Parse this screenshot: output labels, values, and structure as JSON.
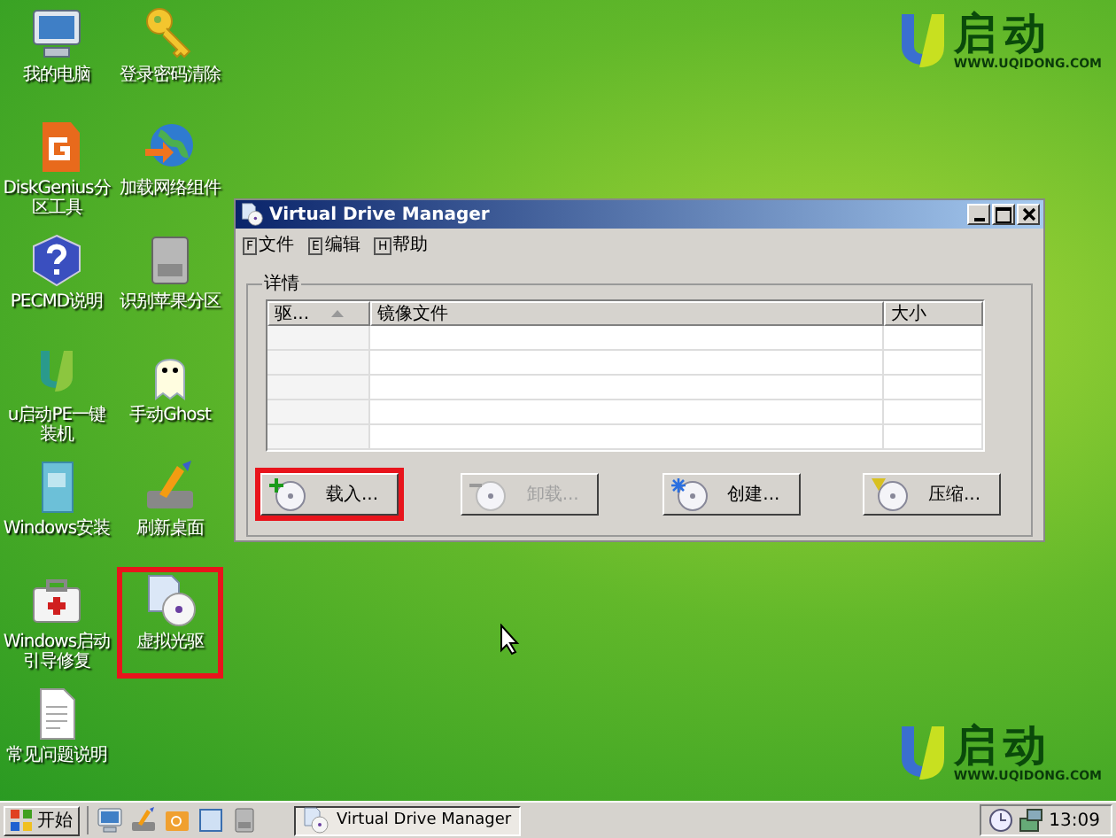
{
  "desktop": {
    "columns": [
      [
        {
          "label": "我的电脑",
          "kind": "computer",
          "highlighted": false
        },
        {
          "label": "DiskGenius分区工具",
          "kind": "diskgenius",
          "highlighted": false
        },
        {
          "label": "PECMD说明",
          "kind": "help",
          "highlighted": false
        },
        {
          "label": "u启动PE一键装机",
          "kind": "ulogo",
          "highlighted": false
        },
        {
          "label": "Windows安装",
          "kind": "book",
          "highlighted": false
        },
        {
          "label": "Windows启动引导修复",
          "kind": "firstaid",
          "highlighted": false
        },
        {
          "label": "常见问题说明",
          "kind": "document",
          "highlighted": false
        }
      ],
      [
        {
          "label": "登录密码清除",
          "kind": "key",
          "highlighted": false
        },
        {
          "label": "加载网络组件",
          "kind": "globe",
          "highlighted": false
        },
        {
          "label": "识别苹果分区",
          "kind": "drive",
          "highlighted": false
        },
        {
          "label": "手动Ghost",
          "kind": "ghost",
          "highlighted": false
        },
        {
          "label": "刷新桌面",
          "kind": "brush",
          "highlighted": false
        },
        {
          "label": "虚拟光驱",
          "kind": "disc",
          "highlighted": true
        }
      ]
    ]
  },
  "logos": [
    {
      "text": "启动",
      "url": "WWW.UQIDONG.COM"
    },
    {
      "text": "启动",
      "url": "WWW.UQIDONG.COM"
    }
  ],
  "window": {
    "title": "Virtual Drive Manager",
    "menus": [
      {
        "key": "F",
        "label": "文件"
      },
      {
        "key": "E",
        "label": "编辑"
      },
      {
        "key": "H",
        "label": "帮助"
      }
    ],
    "group_label": "详情",
    "table": {
      "columns": [
        {
          "label": "驱...",
          "sorted": true
        },
        {
          "label": "镜像文件",
          "sorted": false
        },
        {
          "label": "大小",
          "sorted": false
        }
      ]
    },
    "buttons": [
      {
        "label": "载入...",
        "kind": "add",
        "disabled": false,
        "highlighted": true
      },
      {
        "label": "卸载...",
        "kind": "remove",
        "disabled": true,
        "highlighted": false
      },
      {
        "label": "创建...",
        "kind": "new",
        "disabled": false,
        "highlighted": false
      },
      {
        "label": "压缩...",
        "kind": "compress",
        "disabled": false,
        "highlighted": false
      }
    ]
  },
  "taskbar": {
    "start": "开始",
    "task": "Virtual Drive Manager",
    "clock": "13:09"
  }
}
